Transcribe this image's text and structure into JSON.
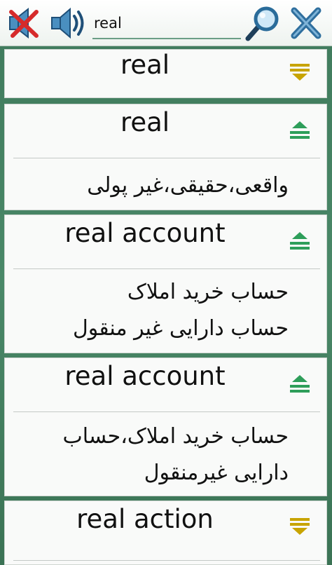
{
  "search": {
    "value": "real"
  },
  "entries": [
    {
      "term": "real",
      "expanded": false
    },
    {
      "term": "real",
      "meaning": "واقعی،حقیقی،غیر پولی",
      "expanded": true
    },
    {
      "term": "real account",
      "meaning": "حساب خرید املاک\nحساب دارایی غیر منقول",
      "expanded": true
    },
    {
      "term": "real account",
      "meaning": "حساب خرید املاک،حساب\nدارایی غیرمنقول",
      "expanded": true
    },
    {
      "term": "real action",
      "expanded": false
    }
  ],
  "colors": {
    "collapsed_arrow": "#c8a400",
    "expanded_arrow": "#2e9e5a",
    "close_x": "#2f6f9e",
    "mute_x": "#d62b2b"
  }
}
